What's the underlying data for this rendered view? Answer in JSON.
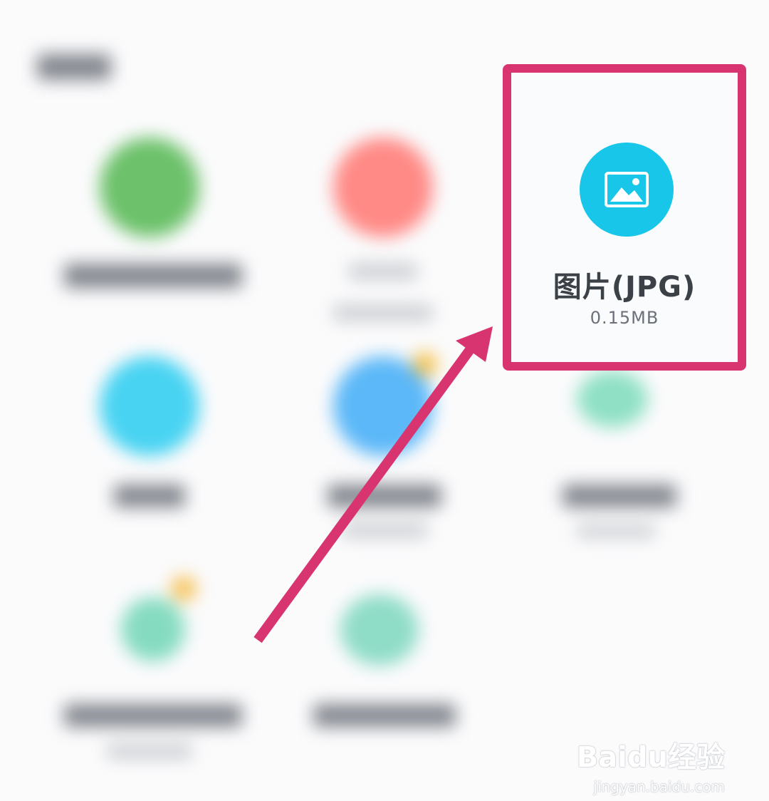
{
  "file": {
    "name": "图片(JPG)",
    "size": "0.15MB",
    "icon": "image-icon"
  },
  "watermark": {
    "logo": "Baidu经验",
    "url": "jingyan.baidu.com"
  },
  "colors": {
    "highlight": "#d73470",
    "file_icon_bg": "#17c6e8"
  }
}
